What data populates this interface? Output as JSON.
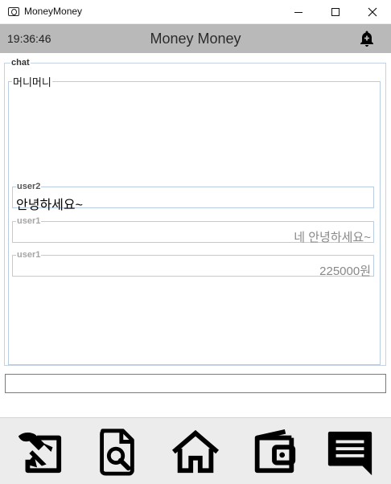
{
  "window": {
    "title": "MoneyMoney"
  },
  "header": {
    "time": "19:36:46",
    "title": "Money Money",
    "notification_icon": "bell-plus-icon"
  },
  "chat": {
    "group_label": "chat",
    "room_name": "머니머니",
    "messages": [
      {
        "user": "user2",
        "text": "안녕하세요~",
        "align": "left"
      },
      {
        "user": "user1",
        "text": "네 안녕하세요~",
        "align": "right"
      },
      {
        "user": "user1",
        "text": "225000원",
        "align": "right"
      }
    ]
  },
  "input": {
    "value": "",
    "placeholder": ""
  },
  "nav": {
    "items": [
      {
        "icon": "edit-document-icon"
      },
      {
        "icon": "search-document-icon"
      },
      {
        "icon": "home-icon"
      },
      {
        "icon": "wallet-icon"
      },
      {
        "icon": "chat-icon"
      }
    ]
  },
  "colors": {
    "header_bg": "#b9b9b9",
    "bottom_bar_bg": "#ececec",
    "border": "#b8cde3"
  }
}
